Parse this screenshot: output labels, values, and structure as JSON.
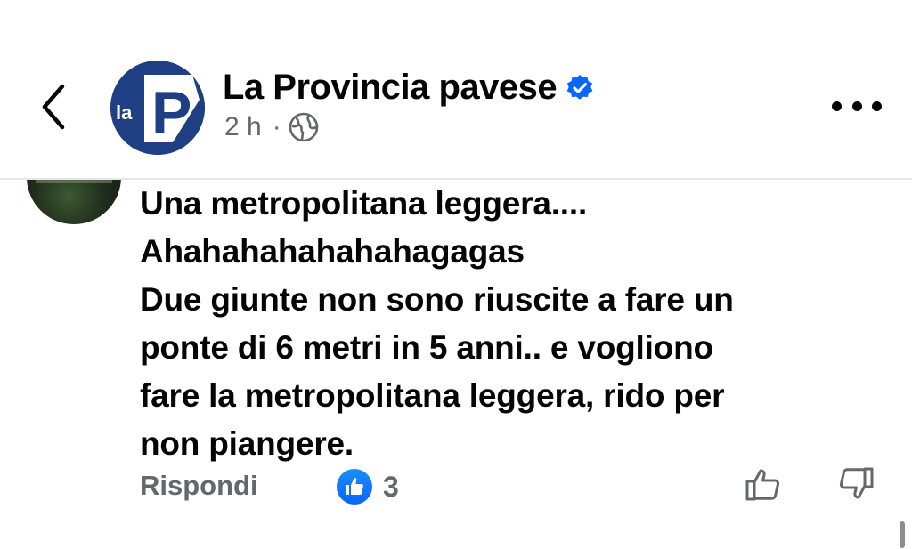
{
  "header": {
    "page_name": "La Provincia pavese",
    "time": "2 h",
    "separator": "·",
    "logo_text_small": "la",
    "logo_text_big": "P"
  },
  "comment": {
    "lines": [
      "Una metropolitana leggera....",
      "Ahahahahahahahagagas",
      "Due giunte non sono riuscite a fare un",
      "ponte di 6 metri in 5 anni.. e vogliono",
      "fare la metropolitana leggera, rido per",
      "non piangere."
    ],
    "reply_label": "Rispondi",
    "like_count": "3"
  },
  "icons": [
    "back-chevron-icon",
    "verified-badge-icon",
    "globe-icon",
    "more-options-icon",
    "like-reaction-icon",
    "thumbs-up-icon",
    "thumbs-down-icon"
  ],
  "colors": {
    "accent_blue": "#0866ff",
    "logo_navy": "#1e3f83",
    "secondary_text": "#65676b",
    "primary_text": "#050505"
  }
}
